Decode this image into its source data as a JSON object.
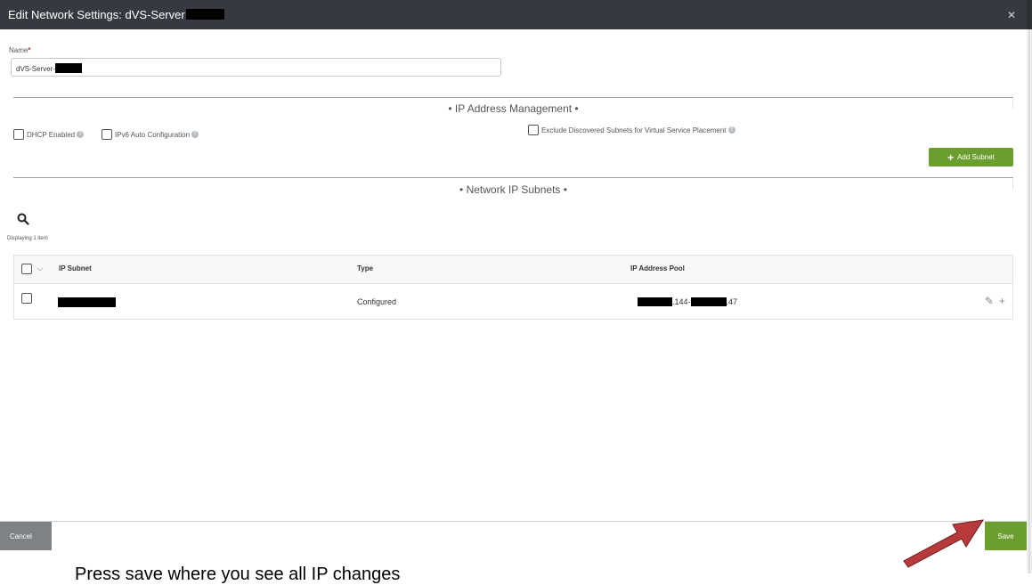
{
  "dialog": {
    "title": "Edit Network Settings: dVS-Server",
    "close_icon": "close-icon"
  },
  "name_field": {
    "label": "Name",
    "required_marker": "*",
    "value": "dVS-Server-"
  },
  "ip_management": {
    "section_title": "• IP Address Management •",
    "dhcp_label": "DHCP Enabled",
    "ipv6_label": "IPv6 Auto Configuration",
    "exclude_label": "Exclude Discovered Subnets for Virtual Service Placement",
    "add_subnet_label": "Add Subnet"
  },
  "subnets": {
    "section_title": "• Network IP Subnets •",
    "displaying": "Displaying 1 item",
    "columns": [
      "IP Subnet",
      "Type",
      "IP Address Pool"
    ],
    "rows": [
      {
        "type": "Configured",
        "pool_mid": ".144-",
        "pool_end": ".47"
      }
    ]
  },
  "footer": {
    "cancel_label": "Cancel",
    "save_label": "Save"
  },
  "caption": "Press save where you see all IP changes",
  "colors": {
    "titlebar": "#363a40",
    "accent_green": "#6c9e2f",
    "cancel_gray": "#7d8287",
    "arrow_red": "#b83a3a"
  }
}
